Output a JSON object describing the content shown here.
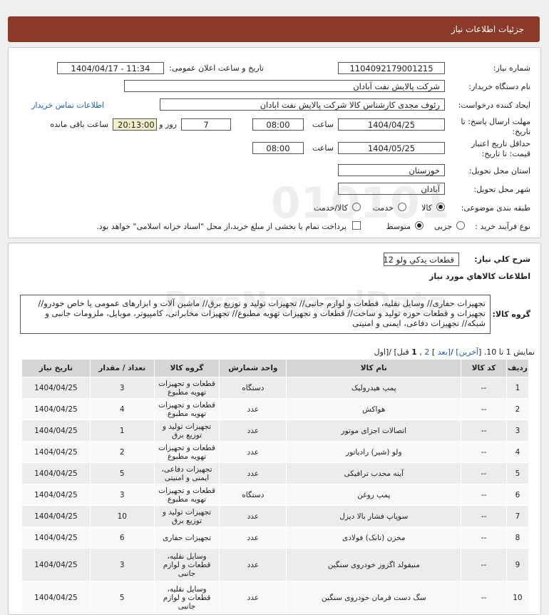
{
  "header": {
    "title": "جزئیات اطلاعات نیاز"
  },
  "form": {
    "need_number_label": "شماره نیاز:",
    "need_number": "1104092179001215",
    "announce_label": "تاریخ و ساعت اعلان عمومی:",
    "announce_value": "1404/04/17 - 11:34",
    "buyer_label": "نام دستگاه خریدار:",
    "buyer_value": "شرکت پالایش نفت آبادان",
    "creator_label": "ایجاد کننده درخواست:",
    "creator_value": "رئوف مجدی کارشناس کالا شرکت پالایش نفت ابادان",
    "contact_link": "اطلاعات تماس خریدار",
    "deadline_label": "مهلت ارسال پاسخ: تا تاریخ:",
    "deadline_date": "1404/04/25",
    "time_label": "ساعت",
    "deadline_time": "08:00",
    "days_value": "7",
    "days_label": "روز و",
    "remaining_time": "20:13:00",
    "remaining_label": "ساعت باقی مانده",
    "validity_label": "حداقل تاریخ اعتبار قیمت: تا تاریخ:",
    "validity_date": "1404/05/25",
    "validity_time": "08:00",
    "province_label": "استان محل تحویل:",
    "province_value": "خوزستان",
    "city_label": "شهر محل تحویل:",
    "city_value": "آبادان",
    "category_label": "طبقه بندی موضوعی:",
    "cat_goods": "کالا",
    "cat_service": "خدمت",
    "cat_goods_service": "کالا/خدمت",
    "process_label": "نوع فرآیند خرید :",
    "proc_partial": "جزیی",
    "proc_medium": "متوسط",
    "payment_text": "پرداخت تمام یا بخشی از مبلغ خرید،از محل \"اسناد خزانه اسلامی\" خواهد بود."
  },
  "summary": {
    "desc_label": "شرح کلي نياز:",
    "desc_value": "قطعات يدكي ولو F12",
    "goods_info_title": "اطلاعات كالاهاي مورد نياز",
    "group_label": "گروه کالا:",
    "group_value": "تجهیزات حفاری// وسایل نقلیه، قطعات و لوازم جانبی// تجهیزات تولید و توزیع برق// ماشین آلات و ابزارهای عمومی یا خاص خودرو// تجهیزات و قطعات حوزه تولید و ساخت// قطعات و تجهیزات تهویه مطبوع// تجهیزات مخابراتی، کامپیوتر، موبایل، ملزومات جانبی و شبکه// تجهیزات دفاعی، ایمنی و امنیتی"
  },
  "pager": {
    "text": "نمایش 1 تا 10.",
    "first": "[اول",
    "prev": "قبل]",
    "current": "1",
    "sep": ", ",
    "next_page": "2",
    "next": "[بعد",
    "last": "آخرین]"
  },
  "table": {
    "headers": [
      "ردیف",
      "کد کالا",
      "نام کالا",
      "واحد شمارش",
      "گروه کالا",
      "تعداد / مقدار",
      "تاریخ نیاز"
    ],
    "rows": [
      [
        "1",
        "--",
        "پمپ هیدرولیک",
        "دستگاه",
        "قطعات و تجهیزات تهویه مطبوع",
        "3",
        "1404/04/25"
      ],
      [
        "2",
        "--",
        "هواکش",
        "عدد",
        "قطعات و تجهیزات تهویه مطبوع",
        "4",
        "1404/04/25"
      ],
      [
        "3",
        "--",
        "اتصالات اجزای موتور",
        "عدد",
        "تجهیزات تولید و توزیع برق",
        "1",
        "1404/04/25"
      ],
      [
        "4",
        "--",
        "ولو (شیر) رادیاتور",
        "عدد",
        "قطعات و تجهیزات تهویه مطبوع",
        "2",
        "1404/04/25"
      ],
      [
        "5",
        "--",
        "آینه محدب ترافیکی",
        "عدد",
        "تجهیزات دفاعی، ایمنی و امنیتی",
        "5",
        "1404/04/25"
      ],
      [
        "6",
        "--",
        "پمپ روغن",
        "دستگاه",
        "قطعات و تجهیزات تهویه مطبوع",
        "3",
        "1404/04/25"
      ],
      [
        "7",
        "--",
        "سوپاپ فشار بالا دیزل",
        "عدد",
        "تجهیزات تولید و توزیع برق",
        "10",
        "1404/04/25"
      ],
      [
        "8",
        "--",
        "مخزن (تانک) فولادی",
        "عدد",
        "تجهیزات حفاری",
        "6",
        "1404/04/25"
      ],
      [
        "9",
        "--",
        "منیفولد اگزوز خودروی سنگین",
        "عدد",
        "وسایل نقلیه، قطعات و لوازم جانبی",
        "3",
        "1404/04/25"
      ],
      [
        "10",
        "--",
        "سگ دست فرمان خودروی سنگین",
        "عدد",
        "وسایل نقلیه، قطعات و لوازم جانبی",
        "5",
        "1404/04/25"
      ]
    ]
  }
}
